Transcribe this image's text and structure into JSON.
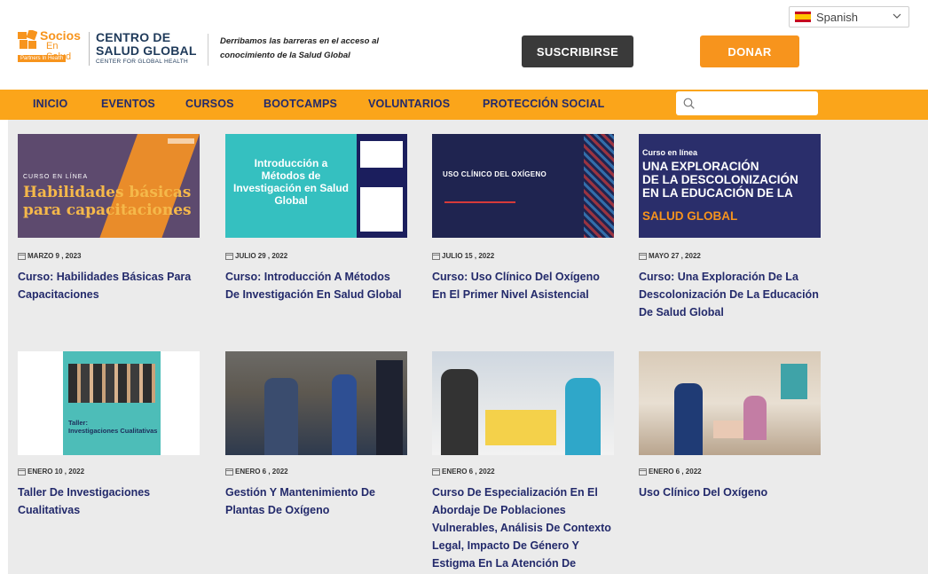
{
  "language": {
    "selected": "Spanish"
  },
  "header": {
    "logo_line1": "Socios",
    "logo_line2": "En Salud",
    "logo_tag": "Partners In Health",
    "centro_line1": "CENTRO DE",
    "centro_line2": "SALUD GLOBAL",
    "centro_line3": "CENTER FOR GLOBAL HEALTH",
    "tagline": "Derribamos las barreras en el acceso al conocimiento de la Salud Global",
    "subscribe": "SUSCRIBIRSE",
    "donate": "DONAR"
  },
  "nav": {
    "items": [
      "INICIO",
      "EVENTOS",
      "CURSOS",
      "BOOTCAMPS",
      "VOLUNTARIOS",
      "PROTECCIÓN SOCIAL"
    ],
    "search_placeholder": ""
  },
  "cards": [
    {
      "date": "MARZO 9 , 2023",
      "title": "Curso: Habilidades Básicas Para Capacitaciones",
      "thumb": {
        "small": "CURSO EN LÍNEA",
        "big1": "Habilidades básicas",
        "big2": "para capacitaciones"
      }
    },
    {
      "date": "JULIO 29 , 2022",
      "title": "Curso: Introducción A Métodos De Investigación En Salud Global",
      "thumb": {
        "text": "Introducción a Métodos de Investigación en Salud Global"
      }
    },
    {
      "date": "JULIO 15 , 2022",
      "title": "Curso: Uso Clínico Del Oxígeno En El Primer Nivel Asistencial",
      "thumb": {
        "text": "USO CLÍNICO DEL OXÍGENO"
      }
    },
    {
      "date": "MAYO 27 , 2022",
      "title": "Curso: Una Exploración De La Descolonización De La Educación De Salud Global",
      "thumb": {
        "small": "Curso en línea",
        "b1": "UNA EXPLORACIÓN",
        "b2": "DE LA DESCOLONIZACIÓN",
        "b3": "EN LA EDUCACIÓN DE LA",
        "o1": "SALUD GLOBAL"
      }
    },
    {
      "date": "ENERO 10 , 2022",
      "title": "Taller De Investigaciones Cualitativas",
      "thumb": {
        "l1": "Taller:",
        "l2": "Investigaciones Cualitativas"
      }
    },
    {
      "date": "ENERO 6 , 2022",
      "title": "Gestión Y Mantenimiento De Plantas De Oxígeno"
    },
    {
      "date": "ENERO 6 , 2022",
      "title": "Curso De Especialización En El Abordaje De Poblaciones Vulnerables, Análisis De Contexto Legal, Impacto De Género Y Estigma En La Atención De"
    },
    {
      "date": "ENERO 6 , 2022",
      "title": "Uso Clínico Del Oxígeno"
    }
  ]
}
